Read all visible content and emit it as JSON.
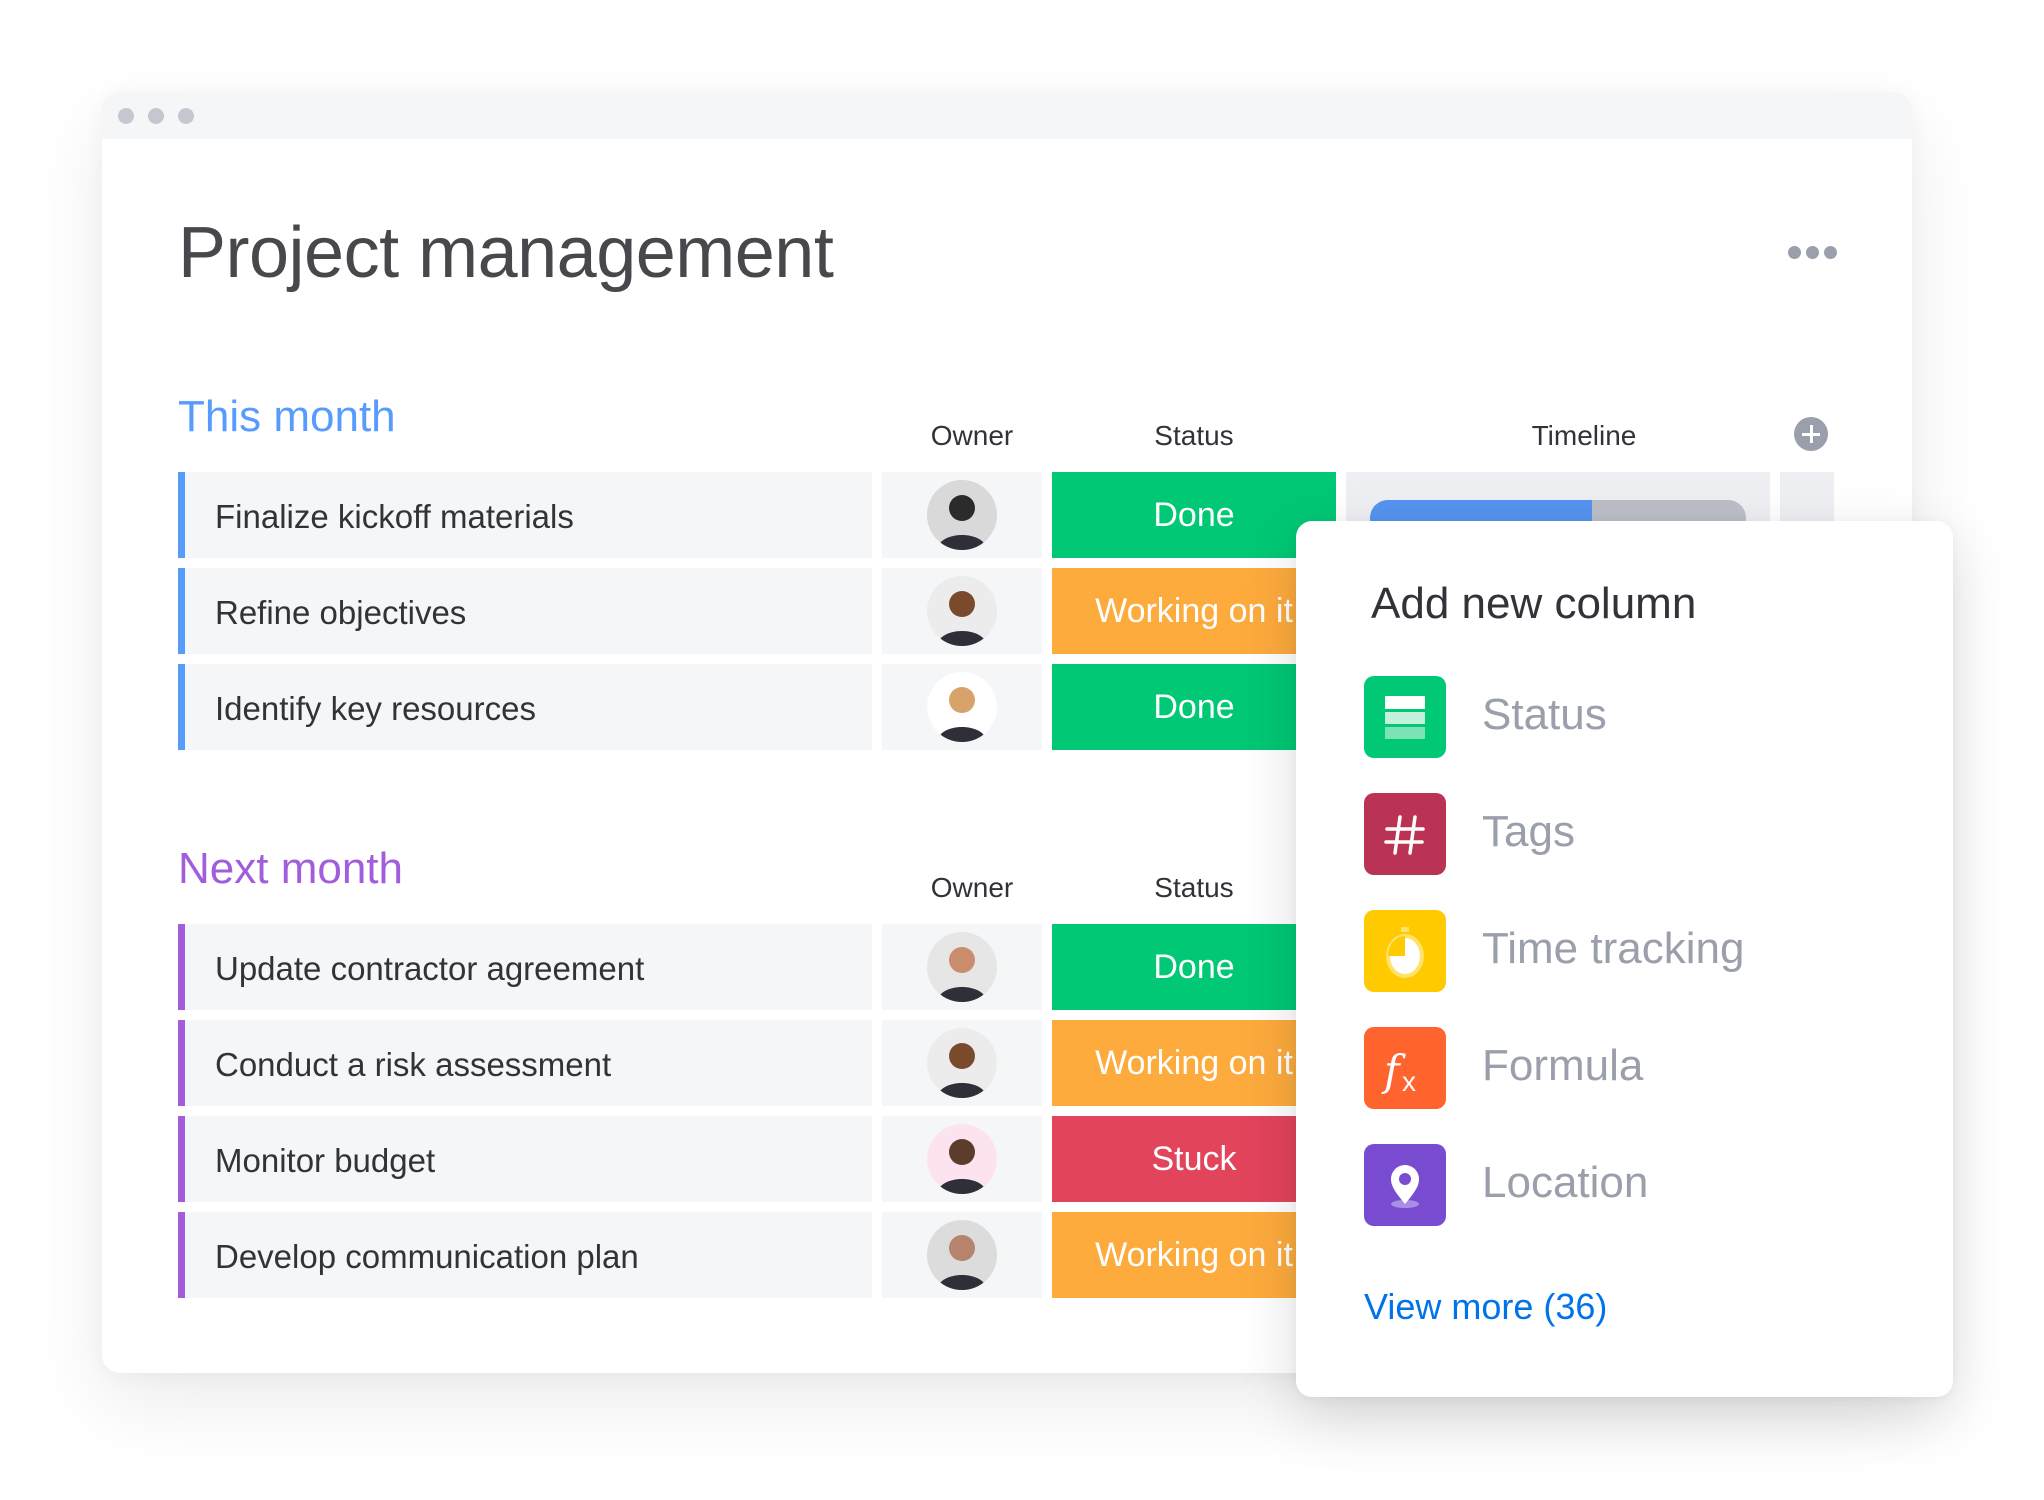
{
  "window": {
    "controls": [
      "dot",
      "dot",
      "dot"
    ]
  },
  "page": {
    "title": "Project management",
    "more_icon": "more-horizontal-icon"
  },
  "groups": [
    {
      "title": "This month",
      "color": "#579bfc",
      "columns": {
        "owner": "Owner",
        "status": "Status",
        "timeline": "Timeline"
      },
      "rows": [
        {
          "name": "Finalize kickoff materials",
          "owner": "Owner 1",
          "status": "Done",
          "status_color": "#00c875",
          "timeline_progress": 0.59
        },
        {
          "name": "Refine objectives",
          "owner": "Owner 2",
          "status": "Working on it",
          "status_color": "#fdab3d"
        },
        {
          "name": "Identify key resources",
          "owner": "Owner 3",
          "status": "Done",
          "status_color": "#00c875"
        }
      ]
    },
    {
      "title": "Next month",
      "color": "#a25ddc",
      "columns": {
        "owner": "Owner",
        "status": "Status"
      },
      "rows": [
        {
          "name": "Update contractor agreement",
          "owner": "Owner 4",
          "status": "Done",
          "status_color": "#00c875"
        },
        {
          "name": "Conduct a risk assessment",
          "owner": "Owner 2",
          "status": "Working on it",
          "status_color": "#fdab3d"
        },
        {
          "name": "Monitor budget",
          "owner": "Owner 5",
          "status": "Stuck",
          "status_color": "#e2445c"
        },
        {
          "name": "Develop communication plan",
          "owner": "Owner 6",
          "status": "Working on it",
          "status_color": "#fdab3d"
        }
      ]
    }
  ],
  "popover": {
    "title": "Add new column",
    "options": [
      {
        "label": "Status",
        "icon": "status-icon",
        "color": "#00c875"
      },
      {
        "label": "Tags",
        "icon": "hashtag-icon",
        "color": "#bb3354"
      },
      {
        "label": "Time tracking",
        "icon": "stopwatch-icon",
        "color": "#ffcb00"
      },
      {
        "label": "Formula",
        "icon": "formula-icon",
        "color": "#ff642e"
      },
      {
        "label": "Location",
        "icon": "location-pin-icon",
        "color": "#784bd1"
      }
    ],
    "view_more": "View more (36)"
  }
}
